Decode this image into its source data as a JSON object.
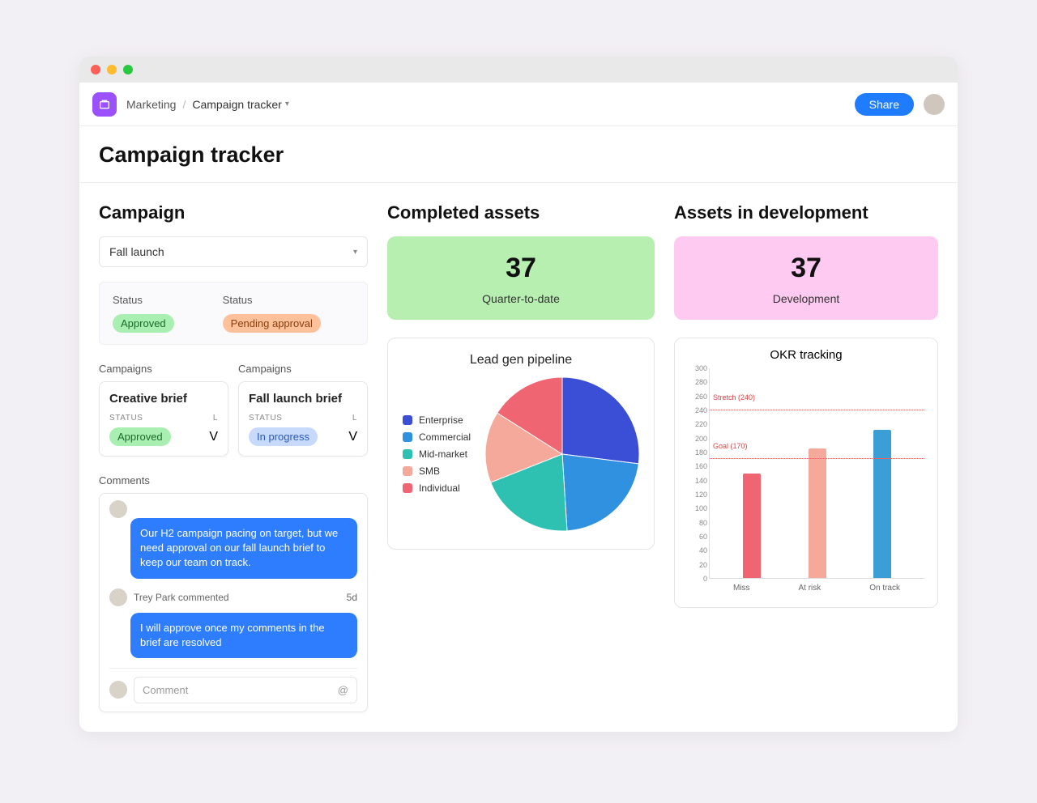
{
  "breadcrumb": {
    "root": "Marketing",
    "current": "Campaign tracker"
  },
  "toolbar": {
    "share": "Share"
  },
  "page": {
    "title": "Campaign tracker"
  },
  "left": {
    "heading": "Campaign",
    "select_value": "Fall launch",
    "status1_label": "Status",
    "status1_value": "Approved",
    "status2_label": "Status",
    "status2_value": "Pending approval",
    "campaigns_label": "Campaigns",
    "card1": {
      "title": "Creative brief",
      "micro": "STATUS",
      "status": "Approved",
      "col2": "L",
      "col2val": "V"
    },
    "card2": {
      "title": "Fall launch brief",
      "micro": "STATUS",
      "status": "In progress",
      "col2": "L",
      "col2val": "V"
    },
    "comments_heading": "Comments",
    "bubble1": "Our H2 campaign pacing on target, but we need approval on our fall launch brief to keep our team on track.",
    "commenter": "Trey Park commented",
    "comment_time": "5d",
    "bubble2": "I will approve once my comments in the brief are resolved",
    "comment_placeholder": "Comment",
    "mention": "@"
  },
  "mid": {
    "heading": "Completed assets",
    "value": "37",
    "caption": "Quarter-to-date",
    "pie_title": "Lead gen pipeline",
    "legend": [
      "Enterprise",
      "Commercial",
      "Mid-market",
      "SMB",
      "Individual"
    ]
  },
  "right": {
    "heading": "Assets in development",
    "value": "37",
    "caption": "Development",
    "bar_title": "OKR tracking"
  },
  "chart_data": [
    {
      "type": "pie",
      "title": "Lead gen pipeline",
      "series": [
        {
          "name": "Enterprise",
          "value": 27,
          "color": "#3a4fd6"
        },
        {
          "name": "Commercial",
          "value": 22,
          "color": "#2f91e0"
        },
        {
          "name": "Mid-market",
          "value": 20,
          "color": "#2ec1b1"
        },
        {
          "name": "SMB",
          "value": 15,
          "color": "#f5a99b"
        },
        {
          "name": "Individual",
          "value": 16,
          "color": "#ef6572"
        }
      ]
    },
    {
      "type": "bar",
      "title": "OKR tracking",
      "categories": [
        "Miss",
        "At risk",
        "On track"
      ],
      "values": [
        150,
        185,
        212
      ],
      "colors": [
        "#ef6572",
        "#f5a99b",
        "#3b9fd6"
      ],
      "ylim": [
        0,
        300
      ],
      "y_ticks": [
        0,
        20,
        40,
        60,
        80,
        100,
        120,
        140,
        160,
        180,
        200,
        220,
        240,
        260,
        280,
        300
      ],
      "reference_lines": [
        {
          "label": "Stretch (240)",
          "value": 240
        },
        {
          "label": "Goal (170)",
          "value": 170
        }
      ]
    }
  ]
}
